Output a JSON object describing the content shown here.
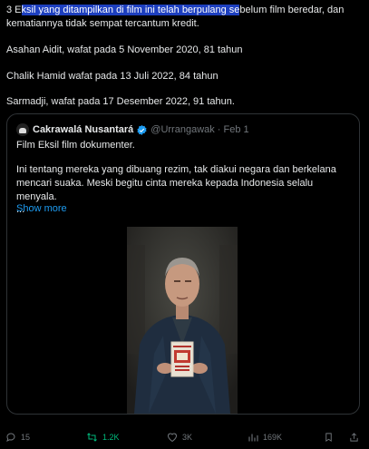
{
  "post": {
    "line1_pre": "3 E",
    "line1_highlight": "ksil yang ditampilkan di film ini telah berpulang se",
    "line1_post": "belum film beredar, dan",
    "line2": "kematiannya tidak sempat tercantum kredit.",
    "para2": "Asahan Aidit, wafat pada 5 November 2020, 81 tahun",
    "para3": "Chalik Hamid wafat pada 13 Juli 2022, 84 tahun",
    "para4": "Sarmadji, wafat pada 17 Desember 2022, 91 tahun."
  },
  "quote": {
    "name": "Cakrawalá Nusantará",
    "handle": "@Urrangawak · Feb 1",
    "line1": "Film Eksil film dokumenter.",
    "line2": "Ini tentang mereka yang dibuang rezim, tak diakui negara dan berkelana mencari suaka. Meski begitu cinta mereka kepada Indonesia selalu menyala.",
    "ellipsis": "...",
    "show_more": "Show more",
    "verified_color": "#1d9bf0"
  },
  "actions": {
    "replies": "15",
    "reposts": "1.2K",
    "likes": "3K",
    "views": "169K",
    "repost_color": "#00ba7c"
  }
}
